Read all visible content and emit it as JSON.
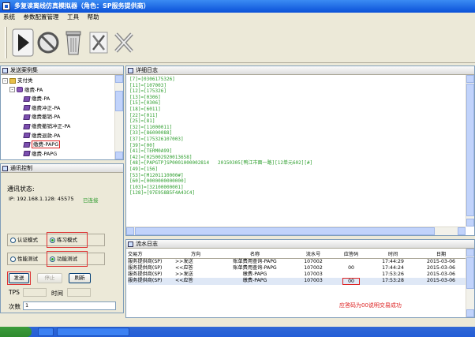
{
  "window": {
    "title": "多复读离线仿真模拟器（角色：SP服务提供商）"
  },
  "menu": [
    "系统",
    "参数配置管理",
    "工具",
    "帮助"
  ],
  "toolbar": {
    "buttons": [
      {
        "name": "start-button",
        "icon": "play-icon"
      },
      {
        "name": "stop-button",
        "icon": "no-entry-icon"
      },
      {
        "name": "clear-button",
        "icon": "trash-icon"
      },
      {
        "name": "tools-button",
        "icon": "tools-icon"
      },
      {
        "name": "close-button",
        "icon": "close-icon"
      }
    ]
  },
  "tree_panel": {
    "title": "发送案例集",
    "nodes": [
      {
        "label": "支付类",
        "icon": "folder",
        "indent": 1,
        "expander": "-"
      },
      {
        "label": "缴费-PA",
        "icon": "gear",
        "indent": 2,
        "expander": "-"
      },
      {
        "label": "缴费-PA",
        "icon": "pack",
        "indent": 3
      },
      {
        "label": "缴费冲正-PA",
        "icon": "pack",
        "indent": 3
      },
      {
        "label": "缴费撤销-PA",
        "icon": "pack",
        "indent": 3
      },
      {
        "label": "缴费撤销冲正-PA",
        "icon": "pack",
        "indent": 3
      },
      {
        "label": "缴费退款-PA",
        "icon": "pack",
        "indent": 3
      },
      {
        "label": "缴费-PAPG",
        "icon": "pack",
        "indent": 3,
        "selected": true
      },
      {
        "label": "缴费-PAPG",
        "icon": "pack",
        "indent": 3
      }
    ]
  },
  "comm_panel": {
    "title": "通讯控制",
    "status_label": "通讯状态:",
    "address": "IP: 192.168.1.128: 45575",
    "connected": "已连接",
    "modes": [
      {
        "label": "认证模式",
        "checked": false
      },
      {
        "label": "练习模式",
        "checked": true
      }
    ],
    "tests": [
      {
        "label": "性能测试",
        "checked": false
      },
      {
        "label": "功能测试",
        "checked": true
      }
    ],
    "send": "发送",
    "stop": "停止",
    "refresh": "刷新",
    "tps_label": "TPS",
    "time_label": "时间",
    "count_label": "次数",
    "count_value": "1"
  },
  "detail_panel": {
    "title": "详细日志",
    "lines": [
      "[7]=[0306175326]",
      "[11]=[107003]",
      "[12]=[175326]",
      "[13]=[0306]",
      "[15]=[0306]",
      "[18]=[6011]",
      "[22]=[011]",
      "[25]=[81]",
      "[32]=[11000011]",
      "[33]=[86000088]",
      "[37]=[175326107003]",
      "[39]=[00]",
      "[41]=[TERM0A99]",
      "[42]=[025002920013658]",
      "[48]=[PAPGTP]SP0001000002814   20150305[鸭江市面一路][12单元602][#]",
      "[49]=[156]",
      "[53]=[M1201110000#]",
      "[60]=[0000000000000]",
      "[103]=[32100000001]",
      "[128]=[97E958B5F4A43C4]"
    ]
  },
  "flow_panel": {
    "title": "流水日志",
    "columns": [
      "交易方",
      "方向",
      "名称",
      "流水号",
      "应答码",
      "时间",
      "日期"
    ],
    "rows": [
      {
        "party": "服务提供商(SP)",
        "dir": ">>发送",
        "name": "账单费用查询-PAPG",
        "serial": "107002",
        "code": "",
        "time": "17:44:29",
        "date": "2015-03-06"
      },
      {
        "party": "服务提供商(SP)",
        "dir": "<<应答",
        "name": "账单费用查询-PAPG",
        "serial": "107002",
        "code": "00",
        "time": "17:44:24",
        "date": "2015-03-06"
      },
      {
        "party": "服务提供商(SP)",
        "dir": ">>发送",
        "name": "缴费-PAPG",
        "serial": "107003",
        "code": "",
        "time": "17:53:26",
        "date": "2015-03-06"
      },
      {
        "party": "服务提供商(SP)",
        "dir": "<<应答",
        "name": "缴费-PAPG",
        "serial": "107003",
        "code": "00",
        "time": "17:53:28",
        "date": "2015-03-06",
        "selected": true
      }
    ],
    "status": "应答码为00说明交易成功"
  }
}
